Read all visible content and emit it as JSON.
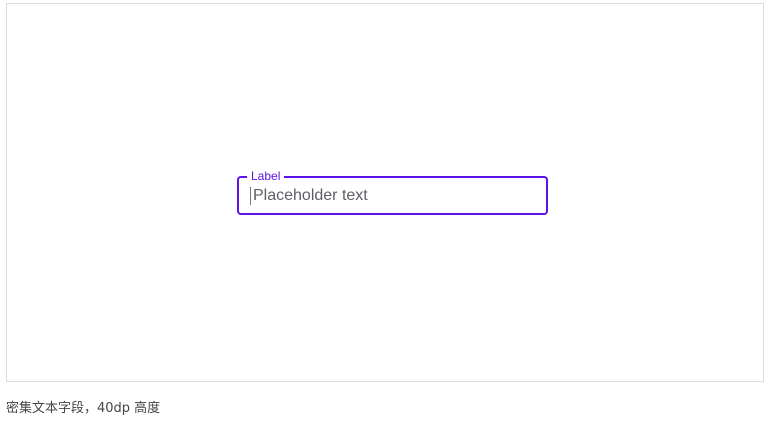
{
  "text_field": {
    "label": "Label",
    "placeholder": "Placeholder text",
    "value": ""
  },
  "caption": {
    "text": "密集文本字段，40dp 高度"
  },
  "colors": {
    "accent": "#5d13e7",
    "placeholder": "#5f5f66",
    "frame_border": "#dcdcdc",
    "caption_text": "#444444"
  }
}
